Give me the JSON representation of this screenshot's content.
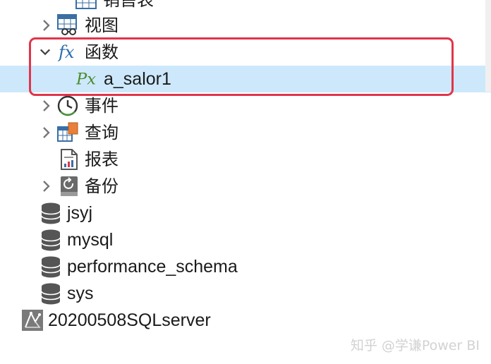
{
  "tree": {
    "top_partial_label": "销售表",
    "items": [
      {
        "label": "视图",
        "expand_state": "collapsed",
        "icon": "view-icon"
      },
      {
        "label": "函数",
        "expand_state": "expanded",
        "icon": "function-fx-icon"
      },
      {
        "label": "a_salor1",
        "expand_state": "none",
        "icon": "procedure-px-icon",
        "selected": true
      },
      {
        "label": "事件",
        "expand_state": "collapsed",
        "icon": "event-clock-icon"
      },
      {
        "label": "查询",
        "expand_state": "collapsed",
        "icon": "query-icon"
      },
      {
        "label": "报表",
        "expand_state": "none",
        "icon": "report-icon"
      },
      {
        "label": "备份",
        "expand_state": "collapsed",
        "icon": "backup-icon"
      },
      {
        "label": "jsyj",
        "icon": "database-icon"
      },
      {
        "label": "mysql",
        "icon": "database-icon"
      },
      {
        "label": "performance_schema",
        "icon": "database-icon"
      },
      {
        "label": "sys",
        "icon": "database-icon"
      },
      {
        "label": "20200508SQLserver",
        "icon": "sqlserver-connection-icon"
      }
    ]
  },
  "colors": {
    "selection": "#cde8fb",
    "highlight_border": "#e0354b",
    "fx_icon": "#2b6cb0",
    "px_icon": "#4a8a2a"
  },
  "watermark": "知乎 @学谦Power BI"
}
